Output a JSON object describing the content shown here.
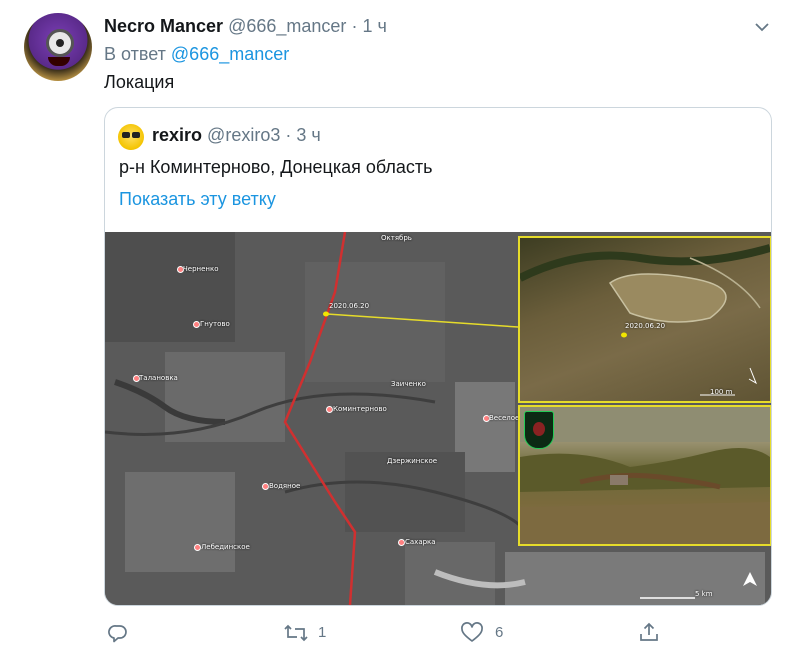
{
  "tweet": {
    "author_name": "Necro Mancer",
    "author_handle": "@666_mancer",
    "separator": "·",
    "time": "1 ч",
    "reply_prefix": "В ответ",
    "reply_to": "@666_mancer",
    "text": "Локация"
  },
  "quoted": {
    "author_name": "rexiro",
    "author_handle": "@rexiro3",
    "separator": "·",
    "time": "3 ч",
    "text": "р-н Коминтерново, Донецкая область",
    "show_thread": "Показать эту ветку",
    "map": {
      "labels": [
        "Октябрь",
        "Черненко",
        "Гнутово",
        "Талановка",
        "Заиченко",
        "Коминтерново",
        "Веселое",
        "Дзержинское",
        "Водяное",
        "Лебединское",
        "Сахарка"
      ],
      "marker_date": "2020.06.20",
      "inset_marker_date": "2020.06.20",
      "inset_scale": "100 m",
      "map_scale": "5 km"
    }
  },
  "actions": {
    "reply_count": "",
    "retweet_count": "1",
    "like_count": "6"
  },
  "colors": {
    "link": "#1b95e0",
    "secondary_text": "#657786",
    "border": "#ccd6dd",
    "marker_line": "#e6dc2a",
    "border_line": "#d03030"
  },
  "icons": [
    "chevron-down-icon",
    "reply-icon",
    "retweet-icon",
    "like-icon",
    "share-icon"
  ]
}
